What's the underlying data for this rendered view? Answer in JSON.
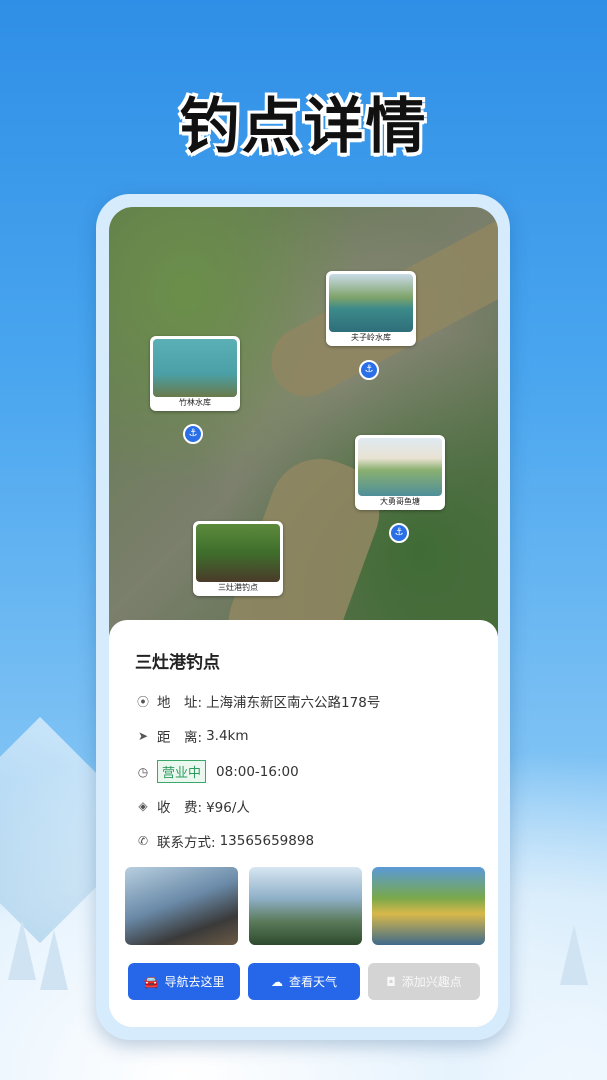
{
  "headline": "钓点详情",
  "map_pins": [
    {
      "name": "夫子岭水库",
      "icon": "fishing-spot-pin-icon"
    },
    {
      "name": "竹林水库",
      "icon": "fishing-spot-pin-icon"
    },
    {
      "name": "大勇哥鱼塘",
      "icon": "fishing-spot-pin-icon"
    },
    {
      "name": "三灶港钓点",
      "icon": "fishing-spot-pin-icon"
    }
  ],
  "spot": {
    "title": "三灶港钓点",
    "address_label": "地　址:",
    "address": "上海浦东新区南六公路178号",
    "distance_label": "距　离:",
    "distance": "3.4km",
    "status_badge": "营业中",
    "hours": "08:00-16:00",
    "fee_label": "收　费:",
    "fee": "¥96/人",
    "contact_label": "联系方式:",
    "contact": "13565659898"
  },
  "icons": {
    "address": "location-icon",
    "distance": "navigation-arrow-icon",
    "hours": "clock-icon",
    "fee": "tag-icon",
    "contact": "phone-icon"
  },
  "buttons": {
    "navigate": "导航去这里",
    "weather": "查看天气",
    "add_poi": "添加兴趣点"
  },
  "colors": {
    "primary": "#2567e8",
    "badge_green": "#2f9a5e",
    "disabled": "#d4d4d4"
  }
}
